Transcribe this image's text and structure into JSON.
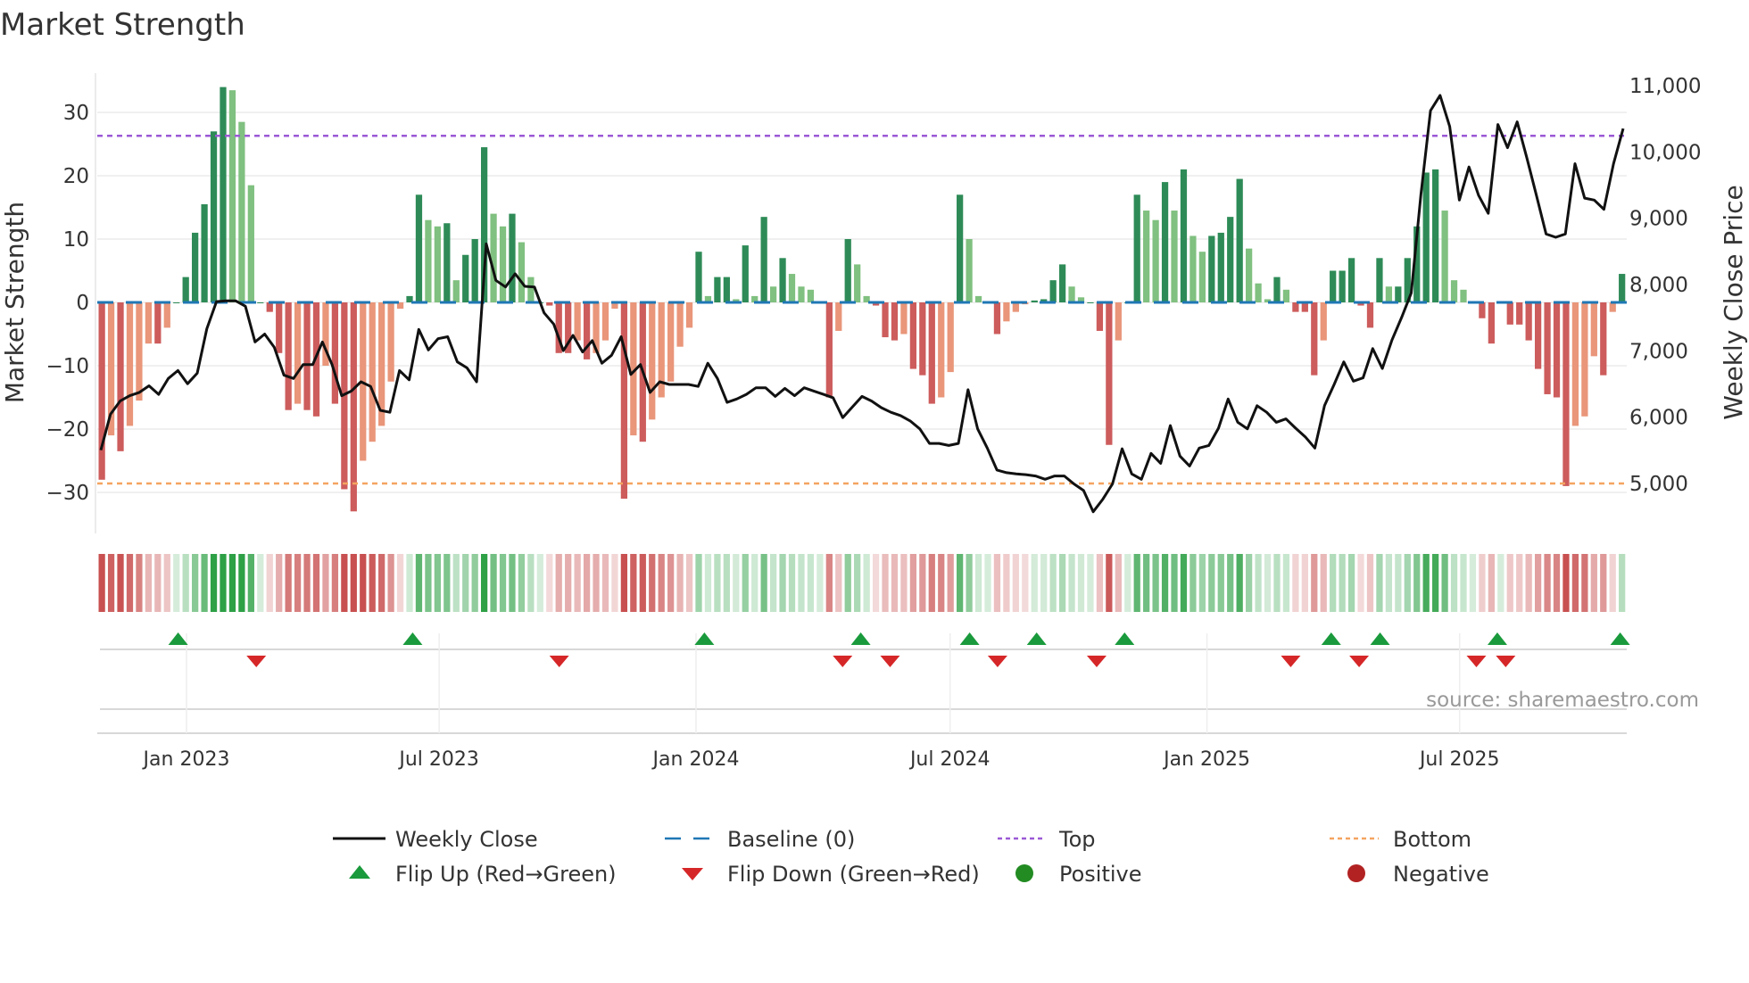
{
  "chart_data": {
    "type": "bar",
    "title": "Market Strength",
    "ylabel": "Market Strength",
    "y2label": "Weekly Close Price",
    "ylim": [
      -37,
      37
    ],
    "y2lim": [
      4300,
      11350
    ],
    "yticks": [
      30,
      20,
      10,
      0,
      -10,
      -20,
      -30
    ],
    "ytick_labels": [
      "30",
      "20",
      "10",
      "0",
      "−10",
      "−20",
      "−30"
    ],
    "y2ticks": [
      11000,
      10000,
      9000,
      8000,
      7000,
      6000,
      5000
    ],
    "y2tick_labels": [
      "11,000",
      "10,000",
      "9,000",
      "8,000",
      "7,000",
      "6,000",
      "5,000"
    ],
    "xticks": [
      {
        "label": "Jan 2023",
        "day": 0
      },
      {
        "label": "Jul 2023",
        "day": 181
      },
      {
        "label": "Jan 2024",
        "day": 365
      },
      {
        "label": "Jul 2024",
        "day": 547
      },
      {
        "label": "Jan 2025",
        "day": 731
      },
      {
        "label": "Jul 2025",
        "day": 912
      }
    ],
    "x_day_range": [
      -64,
      1031
    ],
    "top_level": 26.3,
    "bottom_level": -28.6,
    "baseline": 0,
    "strength": [
      -28,
      -21,
      -23.5,
      -19.5,
      -15.5,
      -6.5,
      -6.5,
      -4,
      0,
      4,
      11,
      15.5,
      27,
      34,
      33.5,
      28.5,
      18.5,
      0,
      -1.5,
      -8,
      -17,
      -16,
      -17,
      -18,
      -10,
      -16,
      -29.5,
      -33,
      -25,
      -22,
      -19.5,
      -12.5,
      -1,
      1,
      17,
      13,
      12,
      12.5,
      3.5,
      7.5,
      10,
      24.5,
      14,
      12,
      14,
      9.5,
      4,
      0,
      -0.5,
      -8,
      -8,
      -6,
      -9,
      -8,
      -6,
      -1,
      -31,
      -21,
      -22,
      -18.5,
      -15,
      -12.5,
      -7,
      -4,
      8,
      1,
      4,
      4,
      0.5,
      9,
      1,
      13.5,
      2.5,
      7,
      4.5,
      2.5,
      2,
      0,
      -15,
      -4.5,
      10,
      6,
      1,
      -0.5,
      -5.5,
      -6,
      -5,
      -10.5,
      -11.5,
      -16,
      -15,
      -11,
      17,
      10,
      1,
      0,
      -5,
      -3,
      -1.5,
      -0.3,
      0.3,
      0.5,
      3.5,
      6,
      2.5,
      0.8,
      0,
      -4.5,
      -22.5,
      -6,
      0,
      17,
      14.5,
      13,
      19,
      14.5,
      21,
      10.5,
      8,
      10.5,
      11,
      13.5,
      19.5,
      8.5,
      3,
      0.5,
      4,
      2,
      -1.5,
      -1.5,
      -11.5,
      -6,
      5,
      5,
      7,
      -0.5,
      -4,
      7,
      2.5,
      2.5,
      7,
      12,
      20.5,
      21,
      14.5,
      3.5,
      2,
      0,
      -2.5,
      -6.5,
      0,
      -3.5,
      -3.5,
      -6,
      -10.5,
      -14.5,
      -15,
      -29,
      -19.5,
      -18,
      -8.5,
      -11.5,
      -1.5,
      4.5
    ],
    "weekly_close": [
      5490,
      6030,
      6230,
      6310,
      6360,
      6460,
      6330,
      6570,
      6690,
      6490,
      6650,
      7320,
      7730,
      7740,
      7740,
      7660,
      7120,
      7240,
      7040,
      6620,
      6570,
      6780,
      6780,
      7120,
      6780,
      6310,
      6380,
      6520,
      6450,
      6090,
      6060,
      6690,
      6550,
      7310,
      7000,
      7170,
      7200,
      6820,
      6730,
      6520,
      8600,
      8050,
      7950,
      8150,
      7960,
      7950,
      7560,
      7390,
      6990,
      7220,
      6970,
      7140,
      6800,
      6920,
      7200,
      6630,
      6780,
      6360,
      6520,
      6480,
      6480,
      6480,
      6450,
      6800,
      6570,
      6210,
      6260,
      6330,
      6430,
      6430,
      6300,
      6420,
      6310,
      6430,
      6380,
      6330,
      6280,
      5980,
      6140,
      6300,
      6230,
      6130,
      6060,
      6010,
      5930,
      5810,
      5590,
      5590,
      5560,
      5590,
      6400,
      5810,
      5520,
      5190,
      5150,
      5130,
      5120,
      5100,
      5050,
      5100,
      5100,
      4980,
      4880,
      4560,
      4750,
      4980,
      5510,
      5130,
      5050,
      5440,
      5290,
      5860,
      5400,
      5250,
      5520,
      5560,
      5820,
      6260,
      5910,
      5810,
      6160,
      6060,
      5910,
      5960,
      5820,
      5690,
      5520,
      6160,
      6480,
      6820,
      6530,
      6580,
      7020,
      6720,
      7150,
      7490,
      7860,
      9340,
      10610,
      10840,
      10370,
      9260,
      9760,
      9330,
      9060,
      10400,
      10050,
      10440,
      9900,
      9330,
      8750,
      8700,
      8750,
      9810,
      9290,
      9260,
      9120,
      9810,
      10340
    ],
    "flip_up_days": [
      -6,
      162,
      371,
      483,
      561,
      609,
      672,
      820,
      855,
      939,
      1027
    ],
    "flip_down_days": [
      50,
      267,
      470,
      504,
      581,
      652,
      791,
      840,
      924,
      945
    ],
    "legend": {
      "weekly_close": "Weekly Close",
      "baseline": "Baseline (0)",
      "top": "Top",
      "bottom": "Bottom",
      "flip_up": "Flip Up (Red→Green)",
      "flip_down": "Flip Down (Green→Red)",
      "positive": "Positive",
      "negative": "Negative"
    },
    "legend_placement": "bottom",
    "source": "source: sharemaestro.com",
    "colors": {
      "pos_strong": "#2e8b57",
      "pos_weak": "#80c080",
      "neg_strong": "#cd5c5c",
      "neg_weak": "#e9967a",
      "baseline": "#1f77b4",
      "top": "#9b59d6",
      "bottom": "#f4a460",
      "flip_up": "#1a9a3c",
      "flip_down": "#d62728",
      "positive": "#228b22",
      "negative": "#b22222",
      "line": "#111111"
    }
  }
}
